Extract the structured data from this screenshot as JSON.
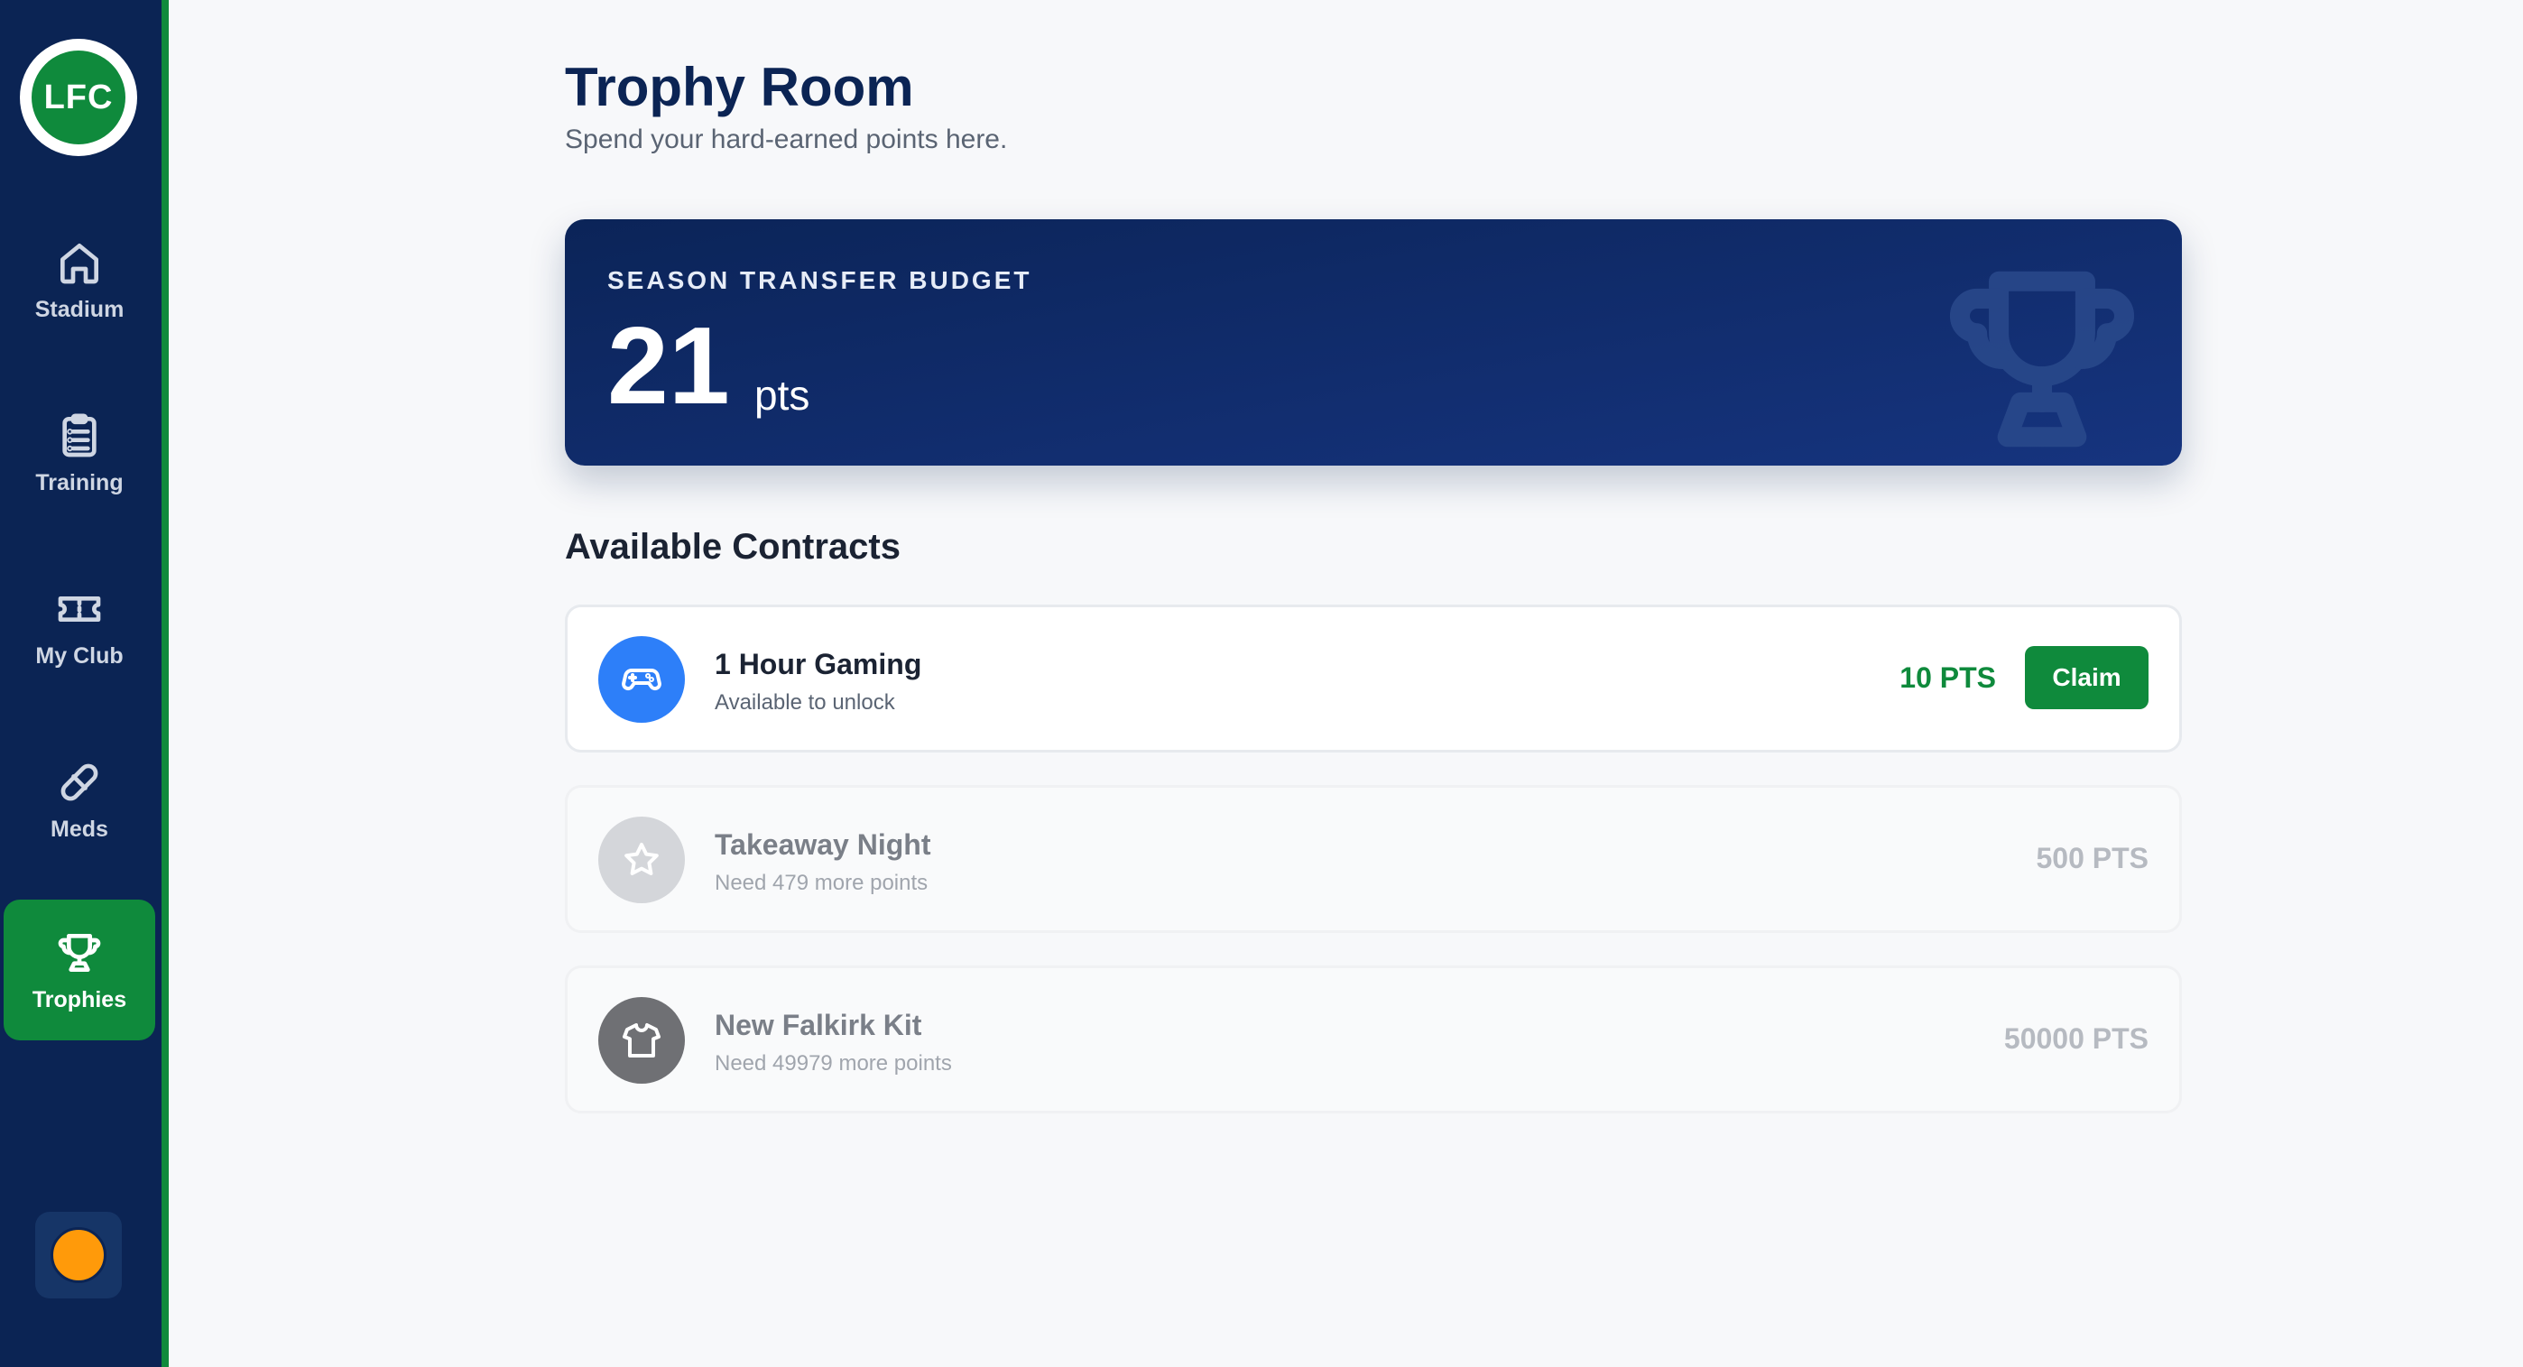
{
  "sidebar": {
    "logo_text": "LFC",
    "items": [
      {
        "label": "Stadium",
        "icon": "home-icon"
      },
      {
        "label": "Training",
        "icon": "clipboard-icon"
      },
      {
        "label": "My Club",
        "icon": "ticket-icon"
      },
      {
        "label": "Meds",
        "icon": "pill-icon"
      },
      {
        "label": "Trophies",
        "icon": "trophy-icon",
        "active": true
      }
    ],
    "avatar_color": "#ff9a0a"
  },
  "header": {
    "title": "Trophy Room",
    "subtitle": "Spend your hard-earned points here."
  },
  "budget": {
    "label": "SEASON TRANSFER BUDGET",
    "value": "21",
    "unit": "pts"
  },
  "contracts": {
    "title": "Available Contracts",
    "items": [
      {
        "name": "1 Hour Gaming",
        "status": "Available to unlock",
        "price": "10 PTS",
        "icon": "gamepad-icon",
        "icon_color": "#2d7ff9",
        "claim_label": "Claim",
        "available": true
      },
      {
        "name": "Takeaway Night",
        "status": "Need 479 more points",
        "price": "500 PTS",
        "icon": "star-icon",
        "icon_color": "#d4d6da",
        "available": false
      },
      {
        "name": "New Falkirk Kit",
        "status": "Need 49979 more points",
        "price": "50000 PTS",
        "icon": "shirt-icon",
        "icon_color": "#6f7074",
        "available": false
      }
    ]
  },
  "colors": {
    "navy": "#0b2454",
    "green": "#0f8a3c",
    "muted": "#b6bac1"
  }
}
